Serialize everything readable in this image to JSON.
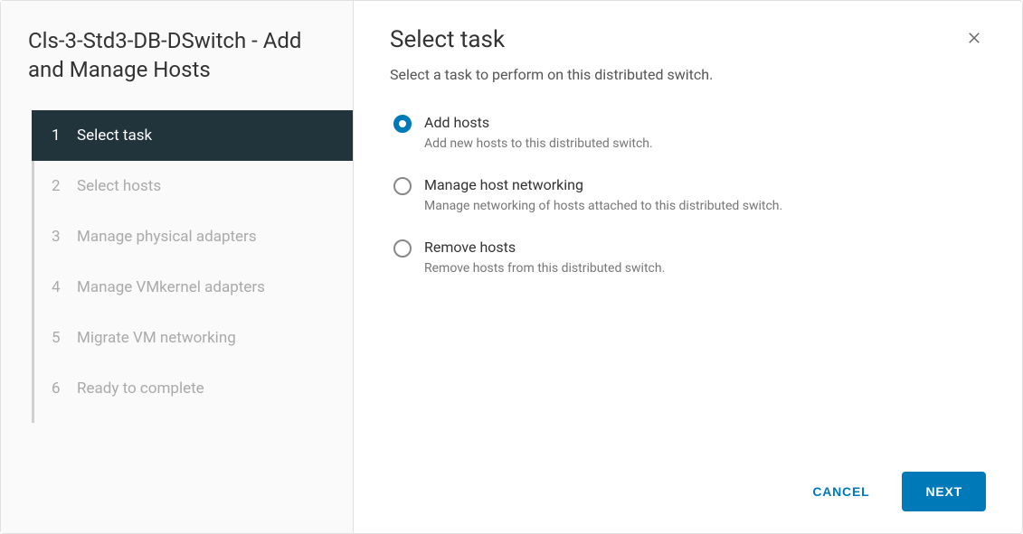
{
  "wizard": {
    "title": "Cls-3-Std3-DB-DSwitch - Add and Manage Hosts",
    "steps": [
      {
        "num": "1",
        "label": "Select task",
        "active": true
      },
      {
        "num": "2",
        "label": "Select hosts",
        "active": false
      },
      {
        "num": "3",
        "label": "Manage physical adapters",
        "active": false
      },
      {
        "num": "4",
        "label": "Manage VMkernel adapters",
        "active": false
      },
      {
        "num": "5",
        "label": "Migrate VM networking",
        "active": false
      },
      {
        "num": "6",
        "label": "Ready to complete",
        "active": false
      }
    ]
  },
  "panel": {
    "title": "Select task",
    "subtitle": "Select a task to perform on this distributed switch.",
    "options": [
      {
        "label": "Add hosts",
        "desc": "Add new hosts to this distributed switch.",
        "selected": true
      },
      {
        "label": "Manage host networking",
        "desc": "Manage networking of hosts attached to this distributed switch.",
        "selected": false
      },
      {
        "label": "Remove hosts",
        "desc": "Remove hosts from this distributed switch.",
        "selected": false
      }
    ]
  },
  "footer": {
    "cancel": "CANCEL",
    "next": "NEXT"
  }
}
